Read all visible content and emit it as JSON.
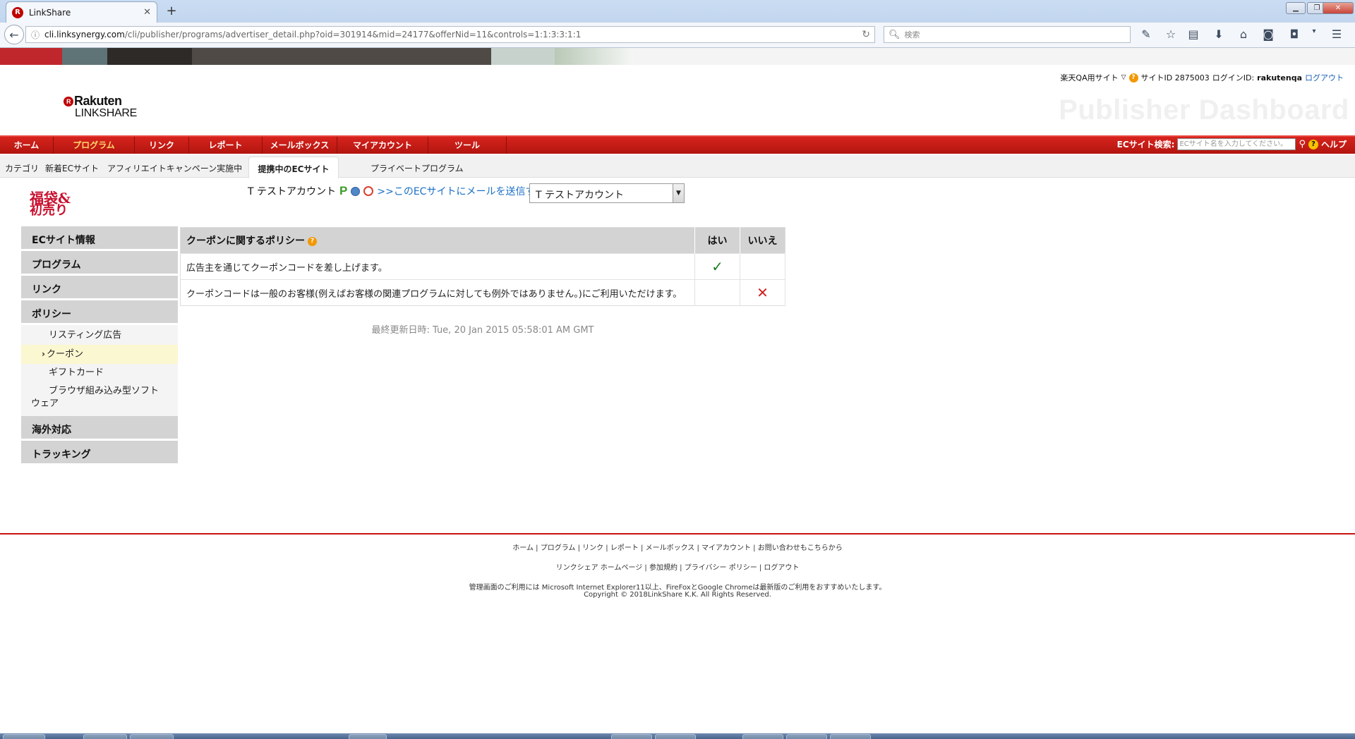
{
  "browser": {
    "tab_title": "LinkShare",
    "tab_close": "✕",
    "newtab": "+",
    "url_host": "cli.linksynergy.com",
    "url_path": "/cli/publisher/programs/advertiser_detail.php?oid=301914&mid=24177&offerNid=11&controls=1:1:3:3:1:1",
    "search_placeholder": "検索",
    "icons": [
      "reader-icon",
      "bookmark-star-icon",
      "bookmarks-list-icon",
      "download-icon",
      "home-icon",
      "pocket-icon",
      "screenshot-icon",
      "menu-icon"
    ]
  },
  "colors": {
    "brand_red": "#bf0000",
    "nav_red": "#c41a14",
    "link_blue": "#1a6fc7",
    "check_green": "#1d7b24",
    "cross_red": "#d11f1f"
  },
  "header": {
    "logo_top": "Rakuten",
    "logo_bottom": "LINKSHARE",
    "site_name": "楽天QA用サイト",
    "site_id_label": "サイトID 2875003",
    "login_label": "ログインID:",
    "login_id": "rakutenqa",
    "logout": "ログアウト",
    "watermark": "Publisher Dashboard"
  },
  "main_nav": {
    "items": [
      "ホーム",
      "プログラム",
      "リンク",
      "レポート",
      "メールボックス",
      "マイアカウント",
      "ツール"
    ],
    "active_index": 1,
    "search_label": "ECサイト検索:",
    "search_placeholder": "ECサイト名を入力してください。",
    "help": "ヘルプ"
  },
  "sub_nav": {
    "items": [
      "カテゴリ",
      "新着ECサイト",
      "アフィリエイトキャンペーン実施中",
      "提携中のECサイト",
      "プライベートプログラム"
    ],
    "active_index": 3
  },
  "advertiser": {
    "logo_text": "福袋&初売り",
    "account_name": "T テストアカウント",
    "send_mail_link": ">>このECサイトにメールを送信する",
    "select_value": "T テストアカウント"
  },
  "sidebar": {
    "sections": [
      "ECサイト情報",
      "プログラム",
      "リンク",
      "ポリシー"
    ],
    "policy_items": [
      "リスティング広告",
      "クーポン",
      "ギフトカード",
      "ブラウザ組み込み型ソフトウェア"
    ],
    "policy_wrap_line1": "ブラウザ組み込み型ソフト",
    "policy_wrap_line2": "ウェア",
    "active_item": "クーポン",
    "after_sections": [
      "海外対応",
      "トラッキング"
    ]
  },
  "coupon_policy": {
    "header": "クーポンに関するポリシー",
    "col_yes": "はい",
    "col_no": "いいえ",
    "rows": [
      {
        "text": "広告主を通じてクーポンコードを差し上げます。",
        "yes": true,
        "no": false
      },
      {
        "text": "クーポンコードは一般のお客様(例えばお客様の関連プログラムに対しても例外ではありません。)にご利用いただけます。",
        "yes": false,
        "no": true
      }
    ],
    "check_mark": "✓",
    "cross_mark": "✕",
    "last_updated": "最終更新日時: Tue, 20 Jan 2015 05:58:01 AM GMT"
  },
  "footer": {
    "row1": "ホーム | プログラム | リンク | レポート | メールボックス | マイアカウント | お問い合わせもこちらから",
    "row2": "リンクシェア ホームページ | 参加規約 | プライバシー ポリシー | ログアウト",
    "row3": "管理画面のご利用には Microsoft Internet Explorer11以上、FireFoxとGoogle Chromeは最新版のご利用をおすすめいたします。",
    "row4": "Copyright © 2018LinkShare K.K. All Rights Reserved."
  }
}
